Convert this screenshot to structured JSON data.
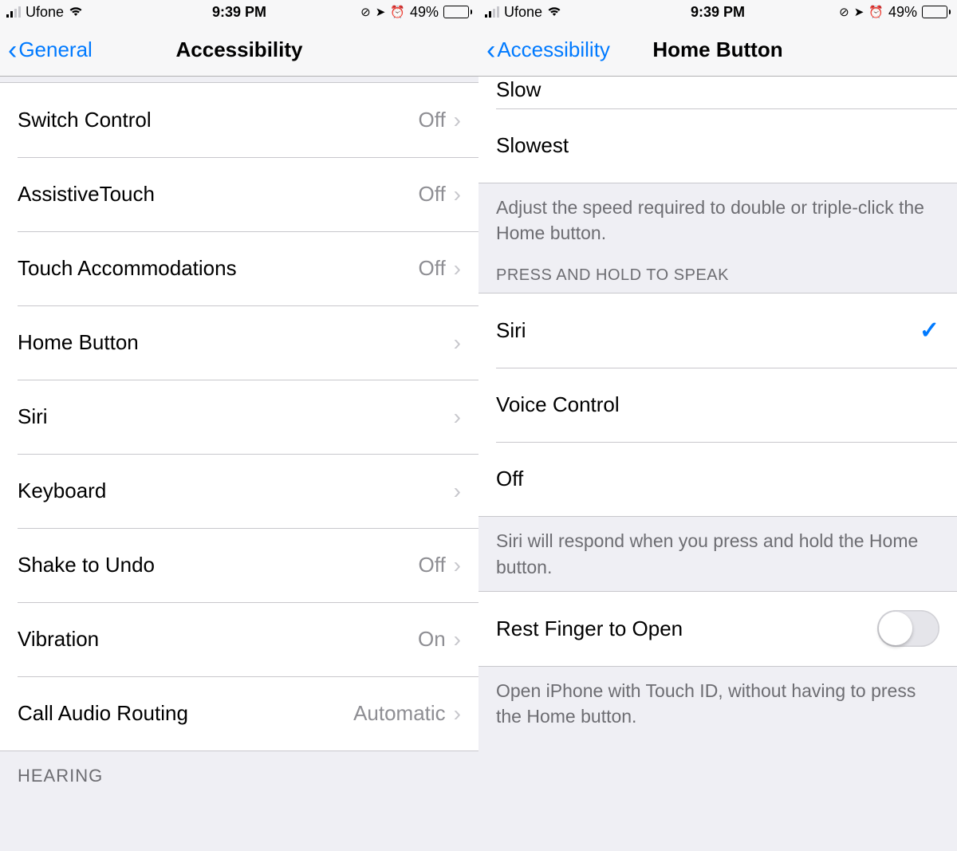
{
  "status": {
    "carrier": "Ufone",
    "time": "9:39 PM",
    "battery_pct": "49%",
    "battery_fill": 49
  },
  "left": {
    "back_label": "General",
    "title": "Accessibility",
    "rows": [
      {
        "label": "Switch Control",
        "value": "Off"
      },
      {
        "label": "AssistiveTouch",
        "value": "Off"
      },
      {
        "label": "Touch Accommodations",
        "value": "Off"
      },
      {
        "label": "Home Button",
        "value": ""
      },
      {
        "label": "Siri",
        "value": ""
      },
      {
        "label": "Keyboard",
        "value": ""
      },
      {
        "label": "Shake to Undo",
        "value": "Off"
      },
      {
        "label": "Vibration",
        "value": "On"
      },
      {
        "label": "Call Audio Routing",
        "value": "Automatic"
      }
    ],
    "next_section_header": "HEARING"
  },
  "right": {
    "back_label": "Accessibility",
    "title": "Home Button",
    "partial_row_label": "Slow",
    "slowest_label": "Slowest",
    "speed_footer": "Adjust the speed required to double or triple-click the Home button.",
    "speak_header": "PRESS AND HOLD TO SPEAK",
    "speak_options": [
      {
        "label": "Siri",
        "checked": true
      },
      {
        "label": "Voice Control",
        "checked": false
      },
      {
        "label": "Off",
        "checked": false
      }
    ],
    "speak_footer": "Siri will respond when you press and hold the Home button.",
    "rest_finger_label": "Rest Finger to Open",
    "rest_finger_on": false,
    "rest_finger_footer": "Open iPhone with Touch ID, without having to press the Home button."
  }
}
